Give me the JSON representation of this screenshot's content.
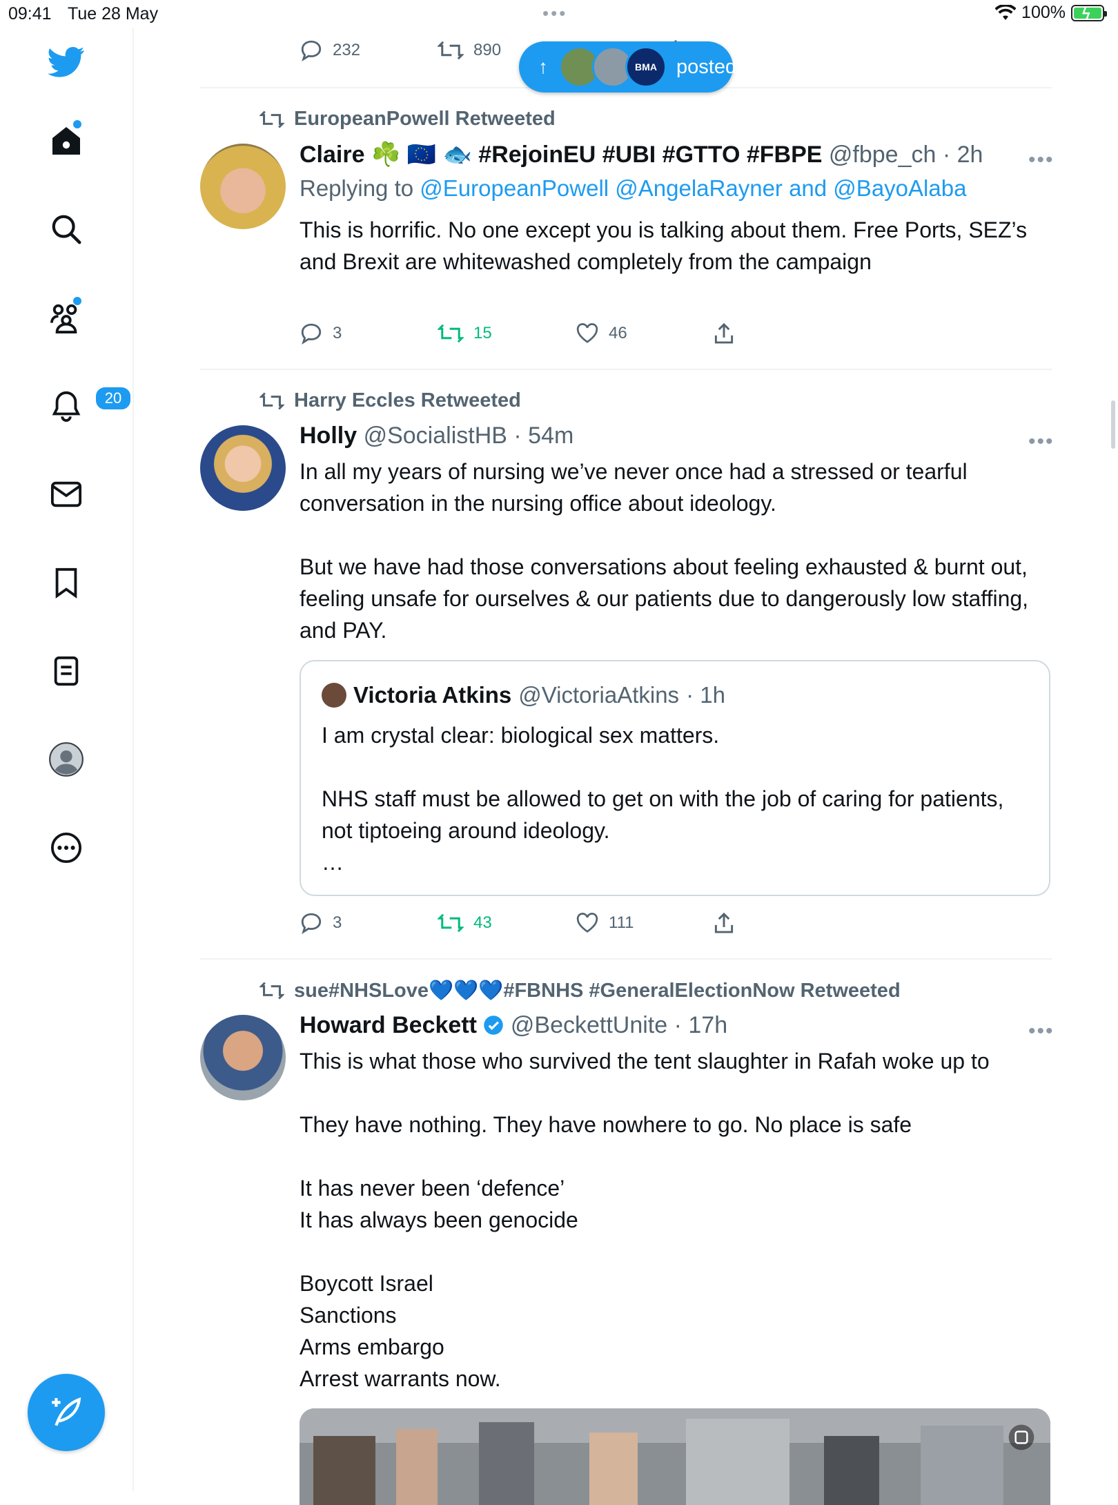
{
  "status_bar": {
    "time": "09:41",
    "date": "Tue 28 May",
    "battery": "100%"
  },
  "sidebar": {
    "notifications_count": "20"
  },
  "new_posts_pill": {
    "label": "posted",
    "avatar_badge": "BMA"
  },
  "top_tweet_actions": {
    "replies": "232",
    "retweets": "890"
  },
  "tweets": [
    {
      "retweeted_by": "EuropeanPowell Retweeted",
      "name": "Claire ☘️ 🇪🇺 🐟 #RejoinEU #UBI #GTTO #FBPE",
      "handle": "@fbpe_ch",
      "time": "· 2h",
      "replying_prefix": "Replying to",
      "replying_to": "@EuropeanPowell @AngelaRayner and @BayoAlaba",
      "text": "This is horrific. No one except you is talking about them. Free Ports, SEZ’s\nand Brexit are whitewashed completely from the campaign",
      "replies": "3",
      "retweets": "15",
      "likes": "46"
    },
    {
      "retweeted_by": "Harry Eccles Retweeted",
      "name": "Holly",
      "handle": "@SocialistHB",
      "time": "· 54m",
      "text": "In all my years of nursing we’ve never once had a stressed or tearful conversation in the nursing office about ideology.\n\nBut we have had those conversations about feeling exhausted & burnt out, feeling unsafe for ourselves & our patients due to dangerously low staffing, and PAY.",
      "quote": {
        "name": "Victoria Atkins",
        "handle": "@VictoriaAtkins",
        "time": "· 1h",
        "text": "I am crystal clear: biological sex matters.\n\nNHS staff must be allowed to get on with the job of caring for patients, not tiptoeing around ideology.\n…"
      },
      "replies": "3",
      "retweets": "43",
      "likes": "111"
    },
    {
      "retweeted_by": "sue#NHSLove💙💙💙#FBNHS #GeneralElectionNow Retweeted",
      "name": "Howard Beckett",
      "handle": "@BeckettUnite",
      "time": "· 17h",
      "text": "This is what those who survived the tent slaughter in Rafah woke up to\n\nThey have nothing. They have nowhere to go. No place is safe\n\nIt has never been ‘defence’\nIt has always been genocide\n\nBoycott Israel\nSanctions\nArms embargo\nArrest warrants now."
    }
  ],
  "colors": {
    "accent": "#1d9bf0",
    "retweet_green": "#00ba7c",
    "muted": "#536471"
  }
}
